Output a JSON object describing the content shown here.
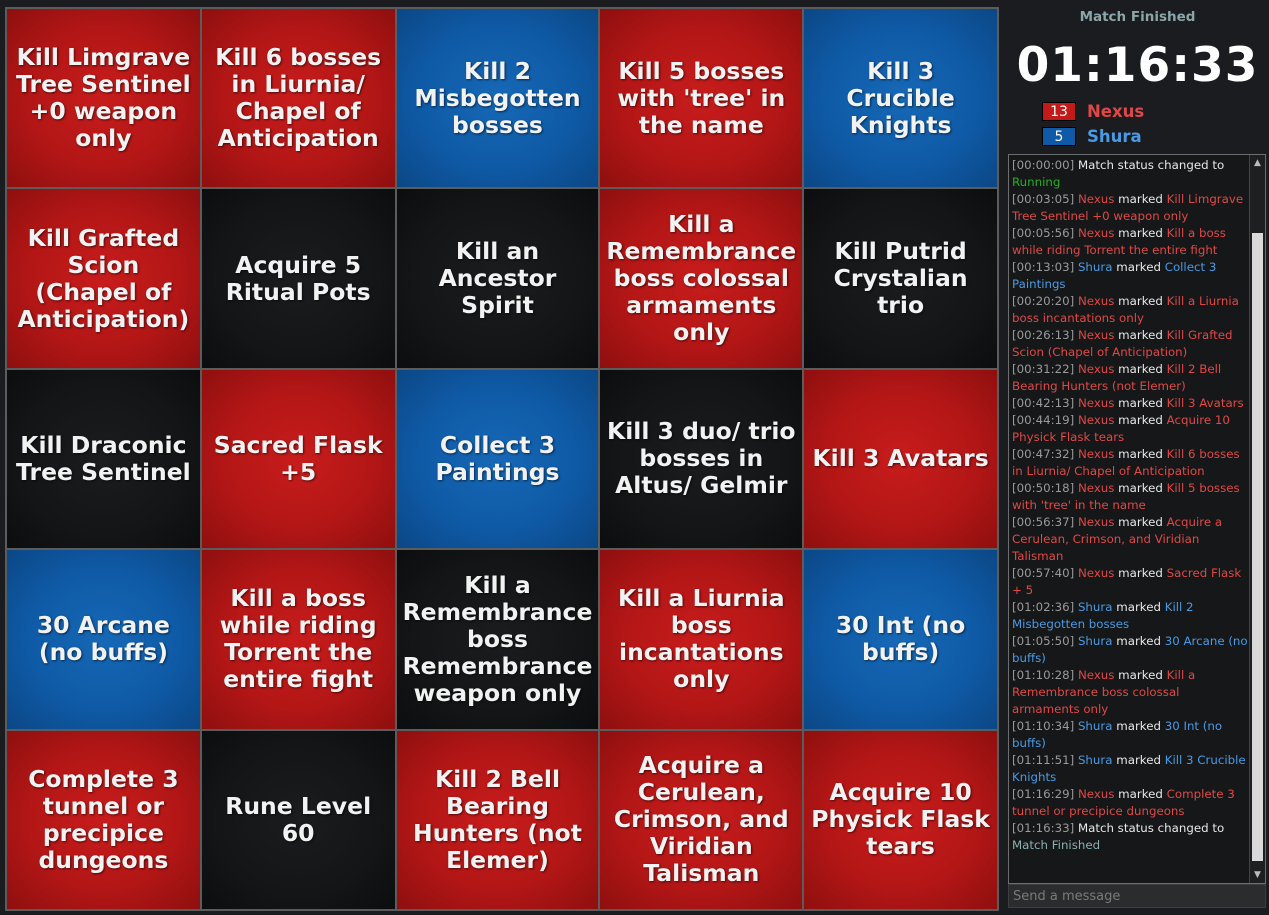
{
  "board": {
    "cells": [
      {
        "text": "Kill Limgrave Tree Sentinel +0 weapon only",
        "color": "red"
      },
      {
        "text": "Kill 6 bosses in Liurnia/ Chapel of Anticipation",
        "color": "red"
      },
      {
        "text": "Kill 2 Misbegotten bosses",
        "color": "blue"
      },
      {
        "text": "Kill 5 bosses with 'tree' in the name",
        "color": "red"
      },
      {
        "text": "Kill 3 Crucible Knights",
        "color": "blue"
      },
      {
        "text": "Kill Grafted Scion (Chapel of Anticipation)",
        "color": "red"
      },
      {
        "text": "Acquire 5 Ritual Pots",
        "color": "black"
      },
      {
        "text": "Kill an Ancestor Spirit",
        "color": "black"
      },
      {
        "text": "Kill a Remembrance boss colossal armaments only",
        "color": "red"
      },
      {
        "text": "Kill Putrid Crystalian trio",
        "color": "black"
      },
      {
        "text": "Kill Draconic Tree Sentinel",
        "color": "black"
      },
      {
        "text": "Sacred Flask +5",
        "color": "red"
      },
      {
        "text": "Collect 3 Paintings",
        "color": "blue"
      },
      {
        "text": "Kill 3 duo/ trio bosses in Altus/ Gelmir",
        "color": "black"
      },
      {
        "text": "Kill 3 Avatars",
        "color": "red"
      },
      {
        "text": "30 Arcane (no buffs)",
        "color": "blue"
      },
      {
        "text": "Kill a boss while riding Torrent the entire fight",
        "color": "red"
      },
      {
        "text": "Kill a Remembrance boss Remembrance weapon only",
        "color": "black"
      },
      {
        "text": "Kill a Liurnia boss incantations only",
        "color": "red"
      },
      {
        "text": "30 Int (no buffs)",
        "color": "blue"
      },
      {
        "text": "Complete 3 tunnel or precipice dungeons",
        "color": "red"
      },
      {
        "text": "Rune Level 60",
        "color": "black"
      },
      {
        "text": "Kill 2 Bell Bearing Hunters (not Elemer)",
        "color": "red"
      },
      {
        "text": "Acquire a Cerulean, Crimson, and Viridian Talisman",
        "color": "red"
      },
      {
        "text": "Acquire 10 Physick Flask tears",
        "color": "red"
      }
    ]
  },
  "colors": {
    "red": "#b31616",
    "blue": "#0f5aa6",
    "black": "#141516",
    "red_text": "#e04848",
    "blue_text": "#4a9ae4",
    "green_text": "#22b022",
    "teal_text": "#8ab0b0"
  },
  "sidebar": {
    "match_status": "Match Finished",
    "timer": "01:16:33",
    "teams": [
      {
        "score": "13",
        "name": "Nexus",
        "color": "#c41a1a",
        "text_color": "#e04848"
      },
      {
        "score": "5",
        "name": "Shura",
        "color": "#0f5aa6",
        "text_color": "#4a9ae4"
      }
    ]
  },
  "chat": {
    "entries": [
      {
        "time": "[00:00:00]",
        "type": "status",
        "pre": "Match status changed to",
        "value": "Running",
        "value_color": "green"
      },
      {
        "time": "[00:03:05]",
        "type": "mark",
        "player": "Nexus",
        "team": "red",
        "verb": "marked",
        "goal": "Kill Limgrave Tree Sentinel +0 weapon only"
      },
      {
        "time": "[00:05:56]",
        "type": "mark",
        "player": "Nexus",
        "team": "red",
        "verb": "marked",
        "goal": "Kill a boss while riding Torrent the entire fight"
      },
      {
        "time": "[00:13:03]",
        "type": "mark",
        "player": "Shura",
        "team": "blue",
        "verb": "marked",
        "goal": "Collect 3 Paintings"
      },
      {
        "time": "[00:20:20]",
        "type": "mark",
        "player": "Nexus",
        "team": "red",
        "verb": "marked",
        "goal": "Kill a Liurnia boss incantations only"
      },
      {
        "time": "[00:26:13]",
        "type": "mark",
        "player": "Nexus",
        "team": "red",
        "verb": "marked",
        "goal": "Kill Grafted Scion (Chapel of Anticipation)"
      },
      {
        "time": "[00:31:22]",
        "type": "mark",
        "player": "Nexus",
        "team": "red",
        "verb": "marked",
        "goal": "Kill 2 Bell Bearing Hunters (not Elemer)"
      },
      {
        "time": "[00:42:13]",
        "type": "mark",
        "player": "Nexus",
        "team": "red",
        "verb": "marked",
        "goal": "Kill 3 Avatars"
      },
      {
        "time": "[00:44:19]",
        "type": "mark",
        "player": "Nexus",
        "team": "red",
        "verb": "marked",
        "goal": "Acquire 10 Physick Flask tears"
      },
      {
        "time": "[00:47:32]",
        "type": "mark",
        "player": "Nexus",
        "team": "red",
        "verb": "marked",
        "goal": "Kill 6 bosses in Liurnia/ Chapel of Anticipation"
      },
      {
        "time": "[00:50:18]",
        "type": "mark",
        "player": "Nexus",
        "team": "red",
        "verb": "marked",
        "goal": "Kill 5 bosses with 'tree' in the name"
      },
      {
        "time": "[00:56:37]",
        "type": "mark",
        "player": "Nexus",
        "team": "red",
        "verb": "marked",
        "goal": "Acquire a Cerulean, Crimson, and Viridian Talisman"
      },
      {
        "time": "[00:57:40]",
        "type": "mark",
        "player": "Nexus",
        "team": "red",
        "verb": "marked",
        "goal": "Sacred Flask + 5"
      },
      {
        "time": "[01:02:36]",
        "type": "mark",
        "player": "Shura",
        "team": "blue",
        "verb": "marked",
        "goal": "Kill 2 Misbegotten bosses"
      },
      {
        "time": "[01:05:50]",
        "type": "mark",
        "player": "Shura",
        "team": "blue",
        "verb": "marked",
        "goal": "30 Arcane (no buffs)"
      },
      {
        "time": "[01:10:28]",
        "type": "mark",
        "player": "Nexus",
        "team": "red",
        "verb": "marked",
        "goal": "Kill a Remembrance boss colossal armaments only"
      },
      {
        "time": "[01:10:34]",
        "type": "mark",
        "player": "Shura",
        "team": "blue",
        "verb": "marked",
        "goal": "30 Int (no buffs)"
      },
      {
        "time": "[01:11:51]",
        "type": "mark",
        "player": "Shura",
        "team": "blue",
        "verb": "marked",
        "goal": "Kill 3 Crucible Knights"
      },
      {
        "time": "[01:16:29]",
        "type": "mark",
        "player": "Nexus",
        "team": "red",
        "verb": "marked",
        "goal": "Complete 3 tunnel or precipice dungeons"
      },
      {
        "time": "[01:16:33]",
        "type": "status",
        "pre": "Match status changed to",
        "value": "Match Finished",
        "value_color": "teal"
      }
    ],
    "input_placeholder": "Send a message",
    "scroll_up_icon": "▲",
    "scroll_down_icon": "▼"
  }
}
